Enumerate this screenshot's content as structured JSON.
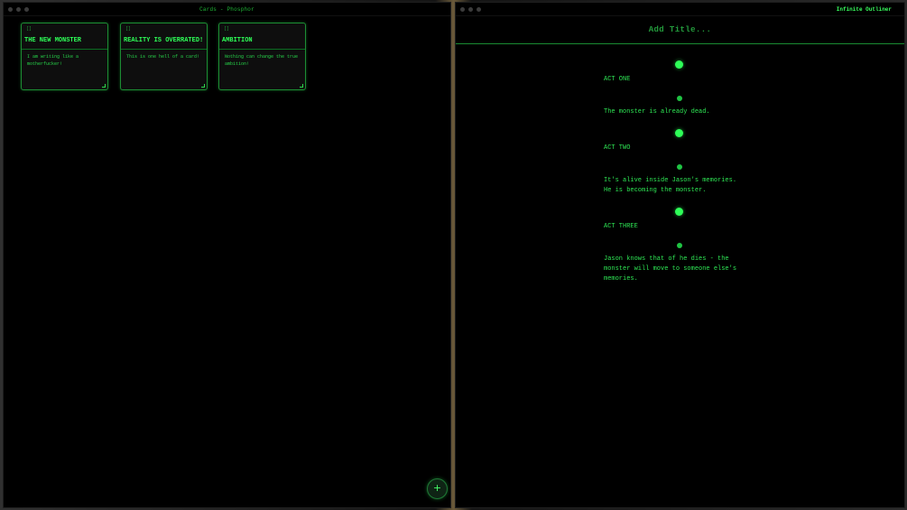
{
  "cards_window": {
    "title": "Cards - Phosphor",
    "cards": [
      {
        "bracket": "[]",
        "title": "THE NEW MONSTER",
        "body": "I am writing like a motherfucker!"
      },
      {
        "bracket": "[]",
        "title": "REALITY IS OVERRATED!",
        "body": "This is one hell of a card!"
      },
      {
        "bracket": "[]",
        "title": "AMBITION",
        "body": "Nothing can change the true ambition!"
      }
    ],
    "add_button": "+"
  },
  "outliner_window": {
    "app_name": "Infinite Outliner",
    "title_placeholder": "Add Title...",
    "nodes": [
      {
        "type": "act",
        "text": "ACT ONE"
      },
      {
        "type": "beat",
        "text": "The monster is already dead."
      },
      {
        "type": "act",
        "text": "ACT TWO"
      },
      {
        "type": "beat",
        "text": "It's alive inside Jason's memories.\nHe is becoming the monster."
      },
      {
        "type": "act",
        "text": "ACT THREE"
      },
      {
        "type": "beat",
        "text": "Jason knows that of he dies - the\nmonster will move to someone else's\nmemories."
      }
    ]
  },
  "colors": {
    "phosphor_green": "#2eff58",
    "dim_green": "#1c8d33",
    "background": "#000000"
  }
}
